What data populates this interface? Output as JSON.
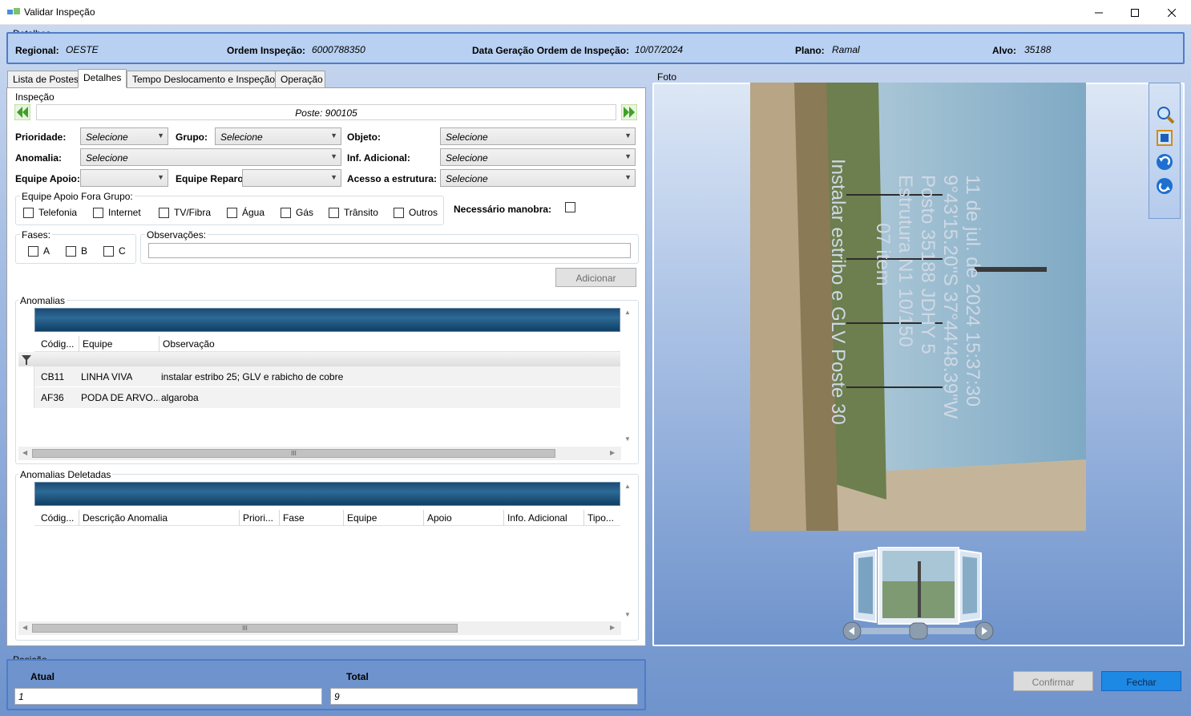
{
  "window": {
    "title": "Validar Inspeção"
  },
  "detalhes": {
    "caption": "Detalhes",
    "regional_label": "Regional:",
    "regional_value": "OESTE",
    "ordem_label": "Ordem Inspeção:",
    "ordem_value": "6000788350",
    "data_label": "Data Geração Ordem de Inspeção:",
    "data_value": "10/07/2024",
    "plano_label": "Plano:",
    "plano_value": "Ramal",
    "alvo_label": "Alvo:",
    "alvo_value": "35188"
  },
  "tabs": [
    "Lista de Postes",
    "Detalhes",
    "Tempo Deslocamento e Inspeção",
    "Operação"
  ],
  "active_tab": "Detalhes",
  "inspecao": {
    "caption": "Inspeção",
    "poste": "Poste: 900105",
    "prioridade_label": "Prioridade:",
    "prioridade_value": "Selecione",
    "grupo_label": "Grupo:",
    "grupo_value": "Selecione",
    "objeto_label": "Objeto:",
    "objeto_value": "Selecione",
    "anomalia_label": "Anomalia:",
    "anomalia_value": "Selecione",
    "inf_label": "Inf. Adicional:",
    "inf_value": "Selecione",
    "equipe_apoio_label": "Equipe Apoio:",
    "equipe_apoio_value": "",
    "equipe_reparo_label": "Equipe Reparo:",
    "equipe_reparo_value": "",
    "acesso_label": "Acesso a estrutura:",
    "acesso_value": "Selecione",
    "fora_grupo_caption": "Equipe Apoio Fora Grupo:",
    "fora_grupo_options": [
      "Telefonia",
      "Internet",
      "TV/Fibra",
      "Água",
      "Gás",
      "Trânsito",
      "Outros"
    ],
    "manobra_label": "Necessário manobra:",
    "fases_caption": "Fases:",
    "fases": [
      "A",
      "B",
      "C"
    ],
    "obs_caption": "Observações:",
    "obs_value": "",
    "adicionar_label": "Adicionar"
  },
  "anomalias": {
    "caption": "Anomalias",
    "columns": [
      "Códig...",
      "Equipe",
      "Observação"
    ],
    "rows": [
      {
        "codigo": "CB11",
        "equipe": "LINHA VIVA",
        "observacao": "instalar estribo 25; GLV e rabicho  de cobre"
      },
      {
        "codigo": "AF36",
        "equipe": "PODA DE ARVO...",
        "observacao": "algaroba"
      }
    ],
    "scroll_grip": "III"
  },
  "deletadas": {
    "caption": "Anomalias Deletadas",
    "columns": [
      "Códig...",
      "Descrição Anomalia",
      "Priori...",
      "Fase",
      "Equipe",
      "Apoio",
      "Info. Adicional",
      "Tipo..."
    ],
    "scroll_grip": "III"
  },
  "foto": {
    "caption": "Foto",
    "overlay_lines": [
      "11 de jul. de 2024 15:37:30",
      "9°43'15.20\"S 37°44'48.39\"W",
      "Posto 35188 JDHY 5",
      "Estrutura N1 10/150",
      "07 item",
      "Instalar estribo e GLV Poste 30"
    ]
  },
  "posicao": {
    "caption": "Posição",
    "atual_label": "Atual",
    "atual_value": "1",
    "total_label": "Total",
    "total_value": "9"
  },
  "footer": {
    "confirmar_label": "Confirmar",
    "fechar_label": "Fechar"
  },
  "colors": {
    "accent": "#0078d7",
    "frame": "#4e7dc6",
    "grid_header": "#1b4b74"
  }
}
